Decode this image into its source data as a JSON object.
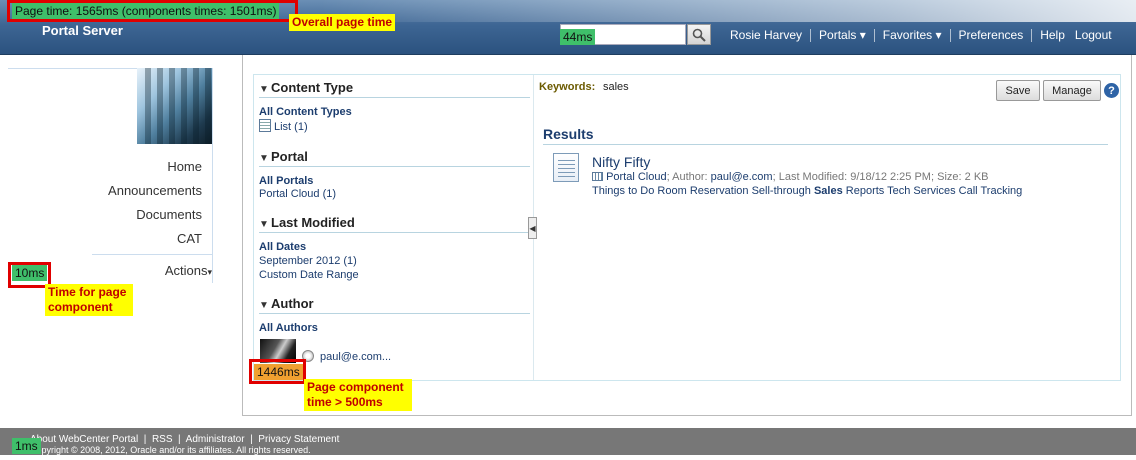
{
  "header": {
    "brand": "Portal Server",
    "page_time": "Page time: 1565ms (components times: 1501ms)",
    "search_timer": "44ms",
    "search_placeholder": "",
    "nav": [
      "Rosie Harvey",
      "Portals",
      "Favorites",
      "Preferences",
      "Help",
      "Logout"
    ]
  },
  "annotations": {
    "overall": "Overall page time",
    "component": "Time for page component",
    "slow": "Page component time > 500ms"
  },
  "left_nav": {
    "items": [
      "Home",
      "Announcements",
      "Documents",
      "CAT"
    ],
    "actions": "Actions",
    "timer": "10ms"
  },
  "facets": {
    "content_type": {
      "title": "Content Type",
      "all": "All Content Types",
      "item": "List (1)"
    },
    "portal": {
      "title": "Portal",
      "all": "All Portals",
      "item": "Portal Cloud (1)"
    },
    "last_modified": {
      "title": "Last Modified",
      "all": "All Dates",
      "item": "September 2012 (1)",
      "item2": "Custom Date Range"
    },
    "author": {
      "title": "Author",
      "all": "All Authors",
      "item": "paul@e.com..."
    },
    "timer": "1446ms"
  },
  "results": {
    "keywords_label": "Keywords:",
    "keywords_value": "sales",
    "save": "Save",
    "manage": "Manage",
    "help": "?",
    "heading": "Results",
    "item": {
      "title": "Nifty Fifty",
      "portal": "Portal Cloud",
      "author_label": "Author:",
      "author": "paul@e.com",
      "modified_label": "Last Modified:",
      "modified": "9/18/12 2:25 PM",
      "size_label": "Size:",
      "size": "2 KB",
      "tags_pre": "Things to Do Room Reservation Sell-through",
      "tags_bold": "Sales",
      "tags_post": "Reports Tech Services Call Tracking"
    }
  },
  "footer": {
    "links": [
      "About WebCenter Portal",
      "RSS",
      "Administrator",
      "Privacy Statement"
    ],
    "copyright": "Copyright © 2008, 2012, Oracle and/or its affiliates. All rights reserved.",
    "timer": "1ms"
  }
}
